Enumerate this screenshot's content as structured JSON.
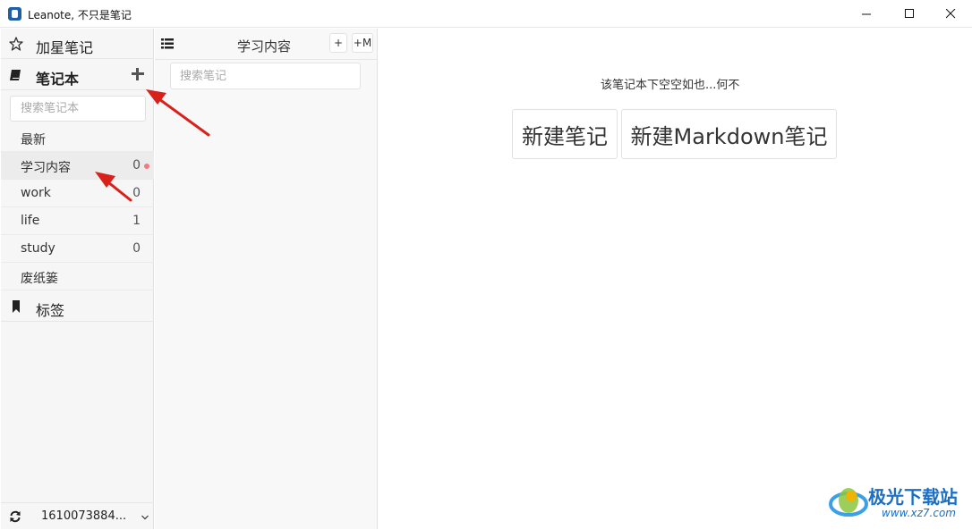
{
  "window": {
    "title": "Leanote, 不只是笔记"
  },
  "sidebar": {
    "starred_label": "加星笔记",
    "notebooks_label": "笔记本",
    "notebook_search_placeholder": "搜索笔记本",
    "items": [
      {
        "name": "最新",
        "count": ""
      },
      {
        "name": "学习内容",
        "count": "0"
      },
      {
        "name": "work",
        "count": "0"
      },
      {
        "name": "life",
        "count": "1"
      },
      {
        "name": "study",
        "count": "0"
      },
      {
        "name": "废纸篓",
        "count": ""
      }
    ],
    "tags_label": "标签",
    "user": "1610073884..."
  },
  "note_list": {
    "title": "学习内容",
    "add_label": "+",
    "add_md_label": "+M",
    "search_placeholder": "搜索笔记"
  },
  "editor": {
    "empty_message": "该笔记本下空空如也...何不",
    "new_note_label": "新建笔记",
    "new_markdown_label": "新建Markdown笔记"
  },
  "watermark": {
    "name": "极光下载站",
    "url": "www.xz7.com"
  },
  "colors": {
    "accent_dot": "#ef7d7d",
    "annotation_arrow": "#d9211c",
    "watermark": "#1a6fc4"
  },
  "icons": {
    "starred": "star-icon",
    "notebooks": "book-icon",
    "tags": "bookmark-icon",
    "sync": "sync-icon",
    "list": "list-icon",
    "add": "plus-icon"
  }
}
